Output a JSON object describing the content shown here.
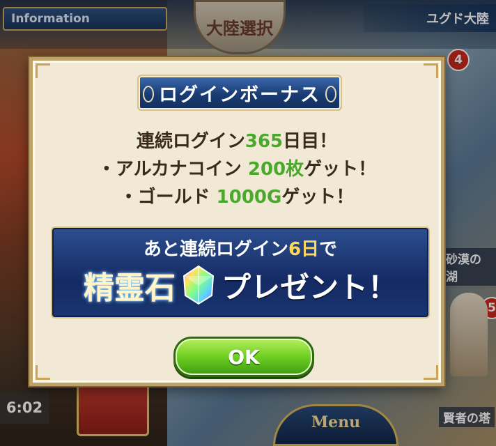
{
  "background": {
    "info_label": "Information",
    "crest_label": "大陸選択",
    "continent_label": "ユグド大陸",
    "badge_top": "4",
    "badge_mid": "5",
    "place_desert": "砂漠の湖",
    "place_tower": "賢者の塔",
    "timer": "6:02",
    "menu_label": "Menu"
  },
  "dialog": {
    "title": "ログインボーナス",
    "line1": {
      "prefix": "連続ログイン",
      "number": "365",
      "suffix": "日目！"
    },
    "line2": {
      "prefix": "・アルカナコイン ",
      "amount": "200枚",
      "suffix": "ゲット！"
    },
    "line3": {
      "prefix": "・ゴールド ",
      "amount": "1000G",
      "suffix": "ゲット！"
    },
    "promo": {
      "top_prefix": "あと連続ログイン",
      "top_days": "6日",
      "top_suffix": "で",
      "item_name": "精霊石",
      "item_icon": "spirit-stone-crystal-icon",
      "present_text": "プレゼント！"
    },
    "ok_label": "OK"
  },
  "colors": {
    "highlight_green": "#4aa82c",
    "banner_blue": "#1a3c73",
    "ok_green": "#6fcf22",
    "dialog_bg": "#f1e9d6"
  }
}
